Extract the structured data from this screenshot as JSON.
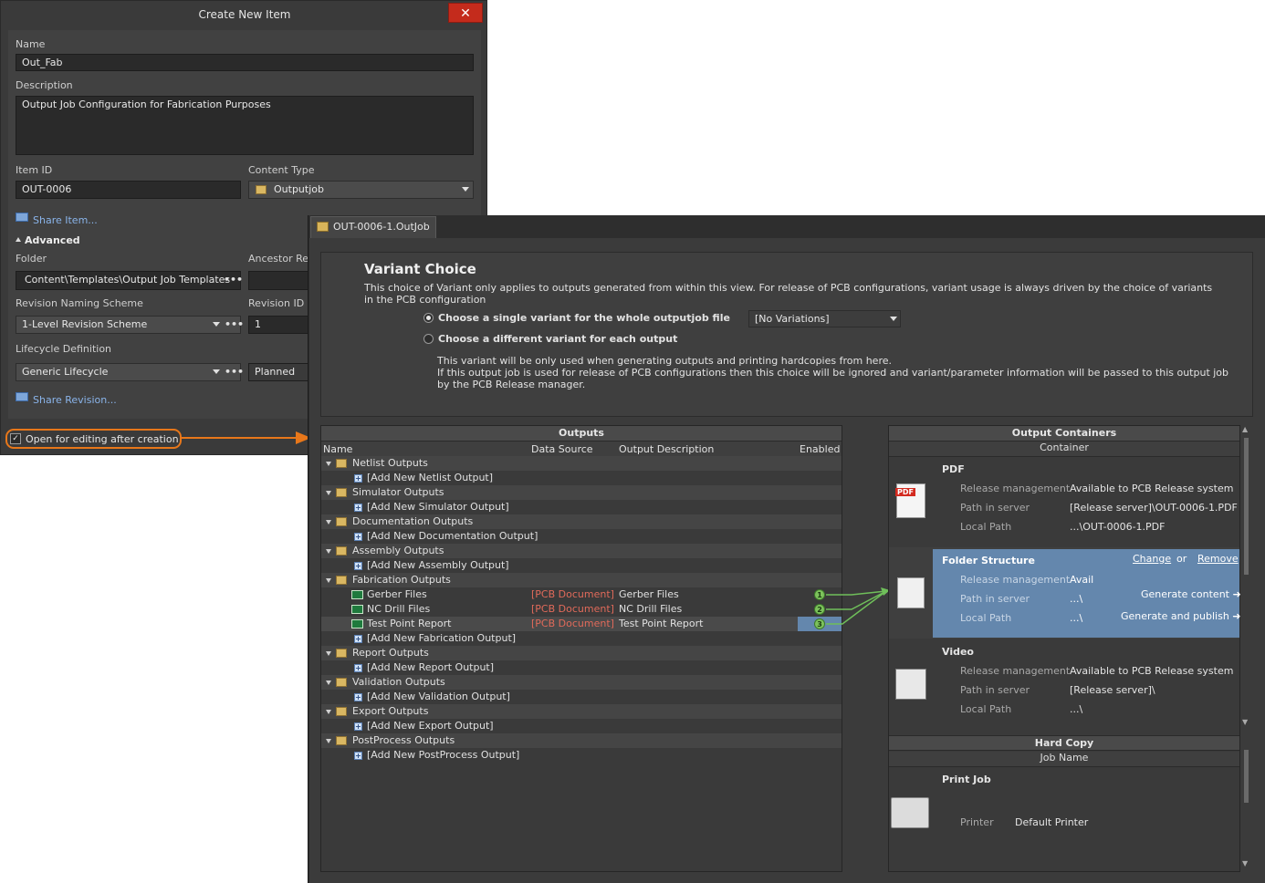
{
  "dialog": {
    "title": "Create New Item",
    "close": "✕",
    "name_label": "Name",
    "name_value": "Out_Fab",
    "description_label": "Description",
    "description_value": "Output Job Configuration for Fabrication Purposes",
    "item_id_label": "Item ID",
    "item_id_value": "OUT-0006",
    "content_type_label": "Content Type",
    "content_type_value": "Outputjob",
    "share_item": "Share Item...",
    "advanced": "Advanced",
    "folder_label": "Folder",
    "folder_value": "Content\\Templates\\Output Job Templates",
    "ancestor_label": "Ancestor Rev",
    "revision_naming_label": "Revision Naming Scheme",
    "revision_naming_value": "1-Level Revision Scheme",
    "revision_id_label": "Revision ID",
    "revision_id_value": "1",
    "lifecycle_label": "Lifecycle Definition",
    "lifecycle_value": "Generic Lifecycle",
    "lifecycle_state": "Planned",
    "share_revision": "Share Revision...",
    "open_for_editing": "Open for editing after creation",
    "dots": "•••",
    "check": "✓"
  },
  "tab": {
    "label": "OUT-0006-1.OutJob *"
  },
  "variant": {
    "title": "Variant Choice",
    "intro": "This choice of Variant only applies to outputs generated from within this view. For release of PCB configurations, variant usage is always driven by the choice of variants in the PCB configuration",
    "option1": "Choose a single variant for the whole outputjob file",
    "option1_value": "[No Variations]",
    "option2": "Choose a different variant for each output",
    "note1": "This variant will be only used when generating outputs and printing hardcopies from here.",
    "note2": "If this output job is used for release of PCB configurations then this choice will be ignored and variant/parameter information will be passed to this output job by the PCB Release manager."
  },
  "outputs": {
    "title": "Outputs",
    "columns": [
      "Name",
      "Data Source",
      "Output Description",
      "Enabled"
    ],
    "groups": [
      {
        "name": "Netlist Outputs",
        "items": [],
        "add": "[Add New Netlist Output]"
      },
      {
        "name": "Simulator Outputs",
        "items": [],
        "add": "[Add New Simulator Output]"
      },
      {
        "name": "Documentation Outputs",
        "items": [],
        "add": "[Add New Documentation Output]"
      },
      {
        "name": "Assembly Outputs",
        "items": [],
        "add": "[Add New Assembly Output]"
      },
      {
        "name": "Fabrication Outputs",
        "items": [
          {
            "name": "Gerber Files",
            "source": "[PCB Document]",
            "desc": "Gerber Files",
            "enabled": "1"
          },
          {
            "name": "NC Drill Files",
            "source": "[PCB Document]",
            "desc": "NC Drill Files",
            "enabled": "2"
          },
          {
            "name": "Test Point Report",
            "source": "[PCB Document]",
            "desc": "Test Point Report",
            "enabled": "3"
          }
        ],
        "add": "[Add New Fabrication Output]"
      },
      {
        "name": "Report Outputs",
        "items": [],
        "add": "[Add New Report Output]"
      },
      {
        "name": "Validation Outputs",
        "items": [],
        "add": "[Add New Validation Output]"
      },
      {
        "name": "Export Outputs",
        "items": [],
        "add": "[Add New Export Output]"
      },
      {
        "name": "PostProcess Outputs",
        "items": [],
        "add": "[Add New PostProcess Output]"
      }
    ]
  },
  "containers": {
    "title": "Output Containers",
    "subtitle": "Container",
    "pdf": {
      "name": "PDF",
      "icon_tag": "PDF",
      "rm_label": "Release management",
      "rm_value": "Available to PCB Release system",
      "pis_label": "Path in server",
      "pis_value": "[Release server]\\OUT-0006-1.PDF",
      "lp_label": "Local Path",
      "lp_value": "...\\OUT-0006-1.PDF"
    },
    "folder": {
      "name": "Folder Structure",
      "change": "Change",
      "or": "or",
      "remove": "Remove",
      "rm_label": "Release management",
      "rm_value": "Avail",
      "pis_label": "Path in server",
      "pis_value": "...\\",
      "lp_label": "Local Path",
      "lp_value": "...\\",
      "generate": "Generate content ➜",
      "publish": "Generate and publish ➜"
    },
    "video": {
      "name": "Video",
      "rm_label": "Release management",
      "rm_value": "Available to PCB Release system",
      "pis_label": "Path in server",
      "pis_value": "[Release server]\\",
      "lp_label": "Local Path",
      "lp_value": "...\\"
    }
  },
  "hardcopy": {
    "title": "Hard Copy",
    "subtitle": "Job Name",
    "job": "Print Job",
    "printer_label": "Printer",
    "printer_value": "Default Printer"
  }
}
